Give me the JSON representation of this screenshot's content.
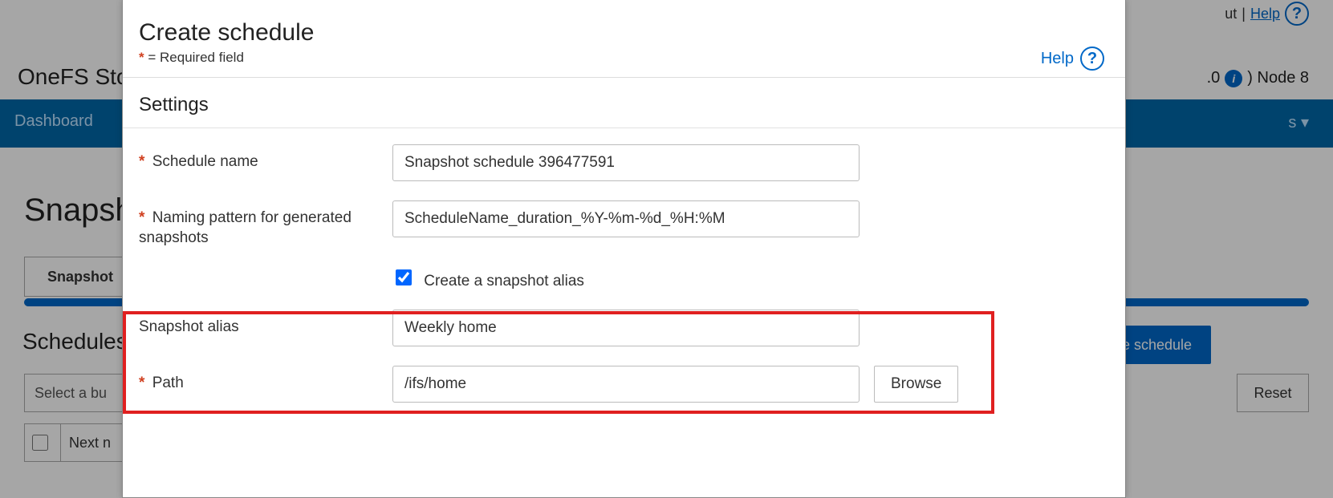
{
  "topbar": {
    "logout": "ut",
    "help": "Help"
  },
  "product": "OneFS Sto",
  "cluster": {
    "version_fragment": ".0",
    "node": ") Node 8"
  },
  "nav": {
    "left": "Dashboard",
    "right_fragment": "s ▾"
  },
  "page_title": "Snapsh",
  "tab": "Snapshot",
  "section_title": "Schedules",
  "buttons": {
    "create": "te schedule",
    "reset": "Reset",
    "bulk": "Select a bu",
    "browse": "Browse"
  },
  "table": {
    "next": "Next n"
  },
  "modal": {
    "title": "Create schedule",
    "required": "= Required field",
    "help": "Help",
    "settings": "Settings",
    "schedule_name_label": "Schedule name",
    "schedule_name_value": "Snapshot schedule 396477591",
    "pattern_label": "Naming pattern for generated snapshots",
    "pattern_value": "ScheduleName_duration_%Y-%m-%d_%H:%M",
    "alias_checkbox_label": "Create a snapshot alias",
    "alias_label": "Snapshot alias",
    "alias_value": "Weekly home",
    "path_label": "Path",
    "path_value": "/ifs/home"
  }
}
